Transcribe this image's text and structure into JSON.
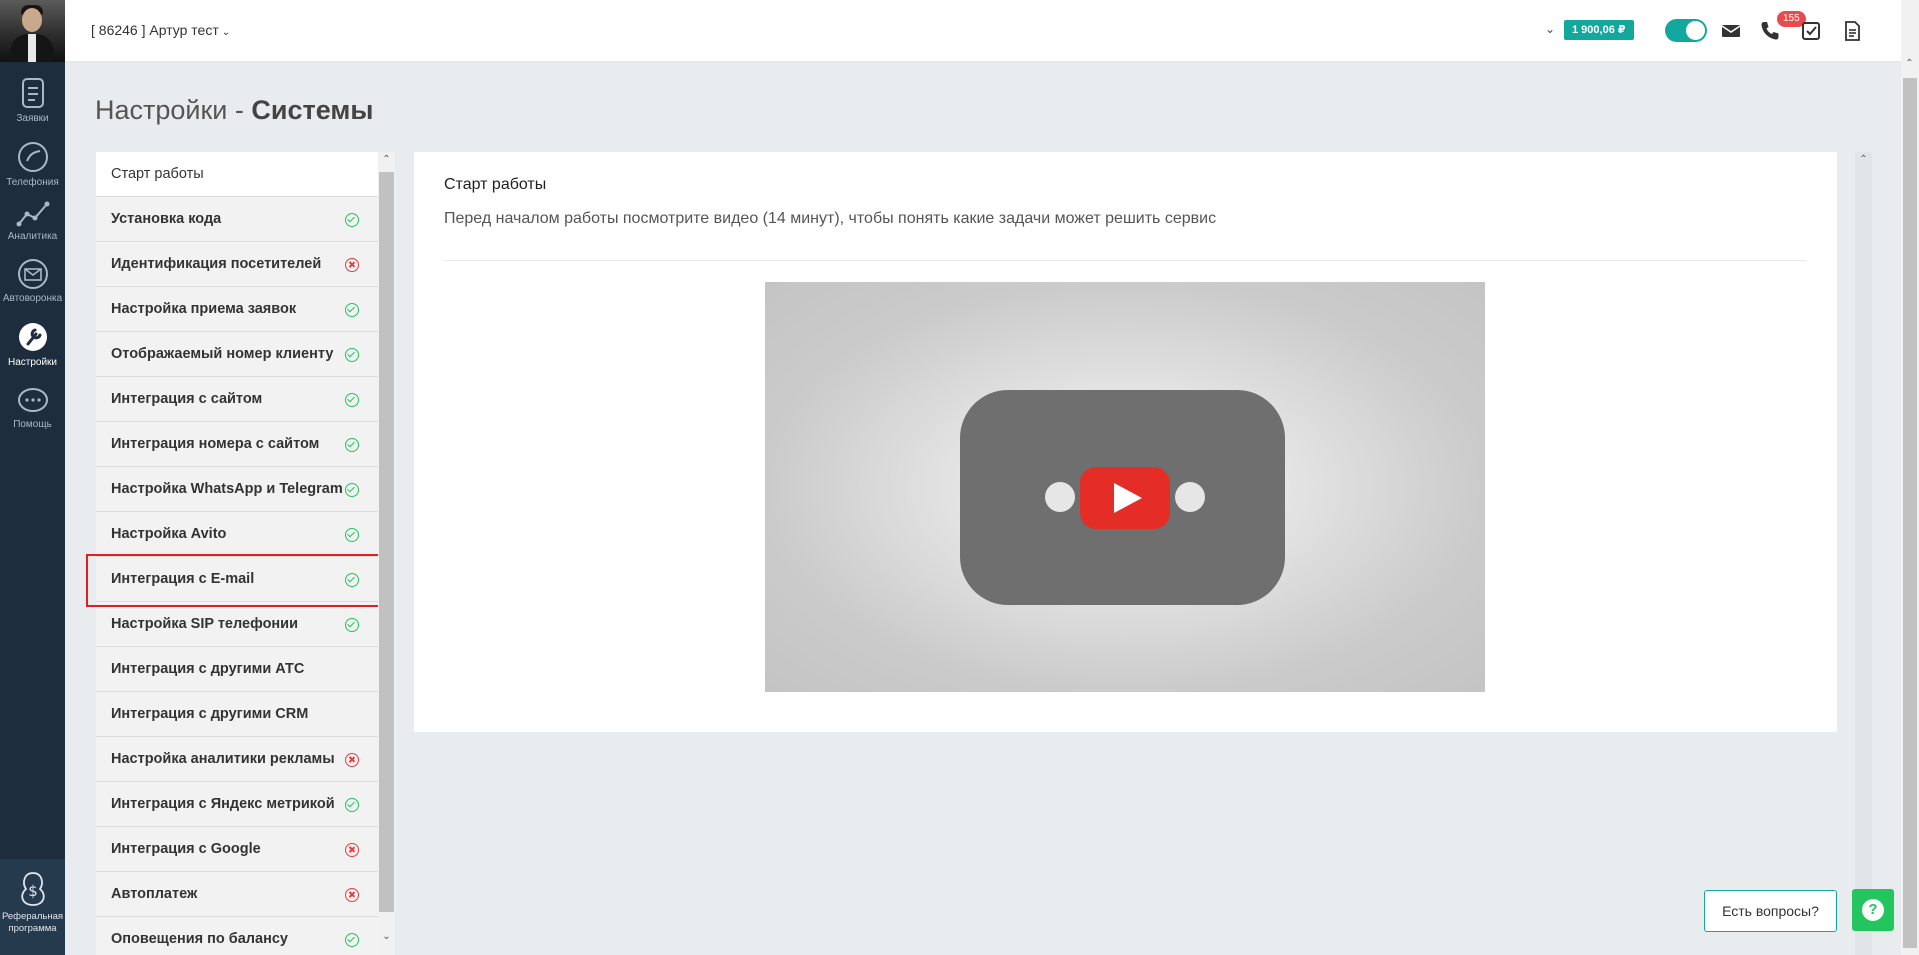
{
  "nav": {
    "items": [
      {
        "label": "Заявки",
        "icon": "requests-icon"
      },
      {
        "label": "Телефония",
        "icon": "phone-icon"
      },
      {
        "label": "Аналитика",
        "icon": "analytics-icon"
      },
      {
        "label": "Автоворонка",
        "icon": "funnel-mail-icon"
      },
      {
        "label": "Настройки",
        "icon": "wrench-icon"
      },
      {
        "label": "Помощь",
        "icon": "chat-icon"
      }
    ],
    "referral_line1": "Реферальная",
    "referral_line2": "программа"
  },
  "topbar": {
    "account": "[ 86246 ] Артур тест",
    "balance": "1 900,06",
    "currency": "₽",
    "notifications_count": "155"
  },
  "page": {
    "title_prefix": "Настройки - ",
    "title_bold": "Системы"
  },
  "settings_list": [
    {
      "label": "Старт работы",
      "status": "none"
    },
    {
      "label": "Установка кода",
      "status": "ok"
    },
    {
      "label": "Идентификация посетителей",
      "status": "error"
    },
    {
      "label": "Настройка приема заявок",
      "status": "ok"
    },
    {
      "label": "Отображаемый номер клиенту",
      "status": "ok"
    },
    {
      "label": "Интеграция с сайтом",
      "status": "ok"
    },
    {
      "label": "Интеграция номера с сайтом",
      "status": "ok"
    },
    {
      "label": "Настройка WhatsApp и Telegram",
      "status": "ok"
    },
    {
      "label": "Настройка Avito",
      "status": "ok"
    },
    {
      "label": "Интеграция с E-mail",
      "status": "ok"
    },
    {
      "label": "Настройка SIP телефонии",
      "status": "ok"
    },
    {
      "label": "Интеграция с другими АТС",
      "status": "none"
    },
    {
      "label": "Интеграция с другими CRM",
      "status": "none"
    },
    {
      "label": "Настройка аналитики рекламы",
      "status": "error"
    },
    {
      "label": "Интеграция с Яндекс метрикой",
      "status": "ok"
    },
    {
      "label": "Интеграция с Google",
      "status": "error"
    },
    {
      "label": "Автоплатеж",
      "status": "error"
    },
    {
      "label": "Оповещения по балансу",
      "status": "ok"
    }
  ],
  "content": {
    "title": "Старт работы",
    "subtitle": "Перед началом работы посмотрите видео (14 минут), чтобы понять какие задачи может решить сервис"
  },
  "widgets": {
    "questions_label": "Есть вопросы?",
    "help_symbol": "?"
  },
  "colors": {
    "accent": "#13a89e",
    "nav_bg": "#1e2d3d",
    "ok": "#22c55e",
    "error": "#e53e3e",
    "highlight": "#e01f1f"
  }
}
